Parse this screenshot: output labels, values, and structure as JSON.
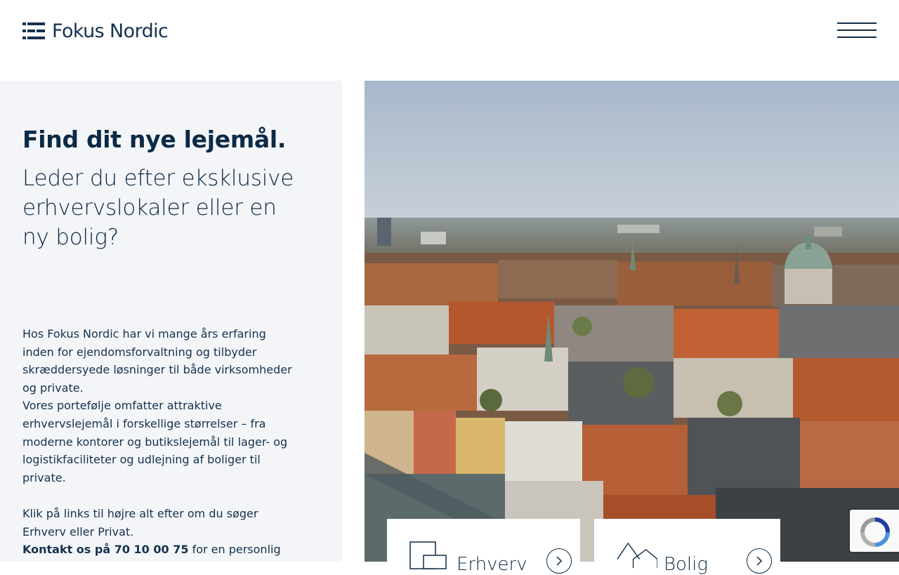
{
  "header": {
    "logo_text": "Fokus Nordic",
    "logo_icon": "fokus-nordic-mark",
    "menu_icon": "hamburger-menu-icon"
  },
  "intro": {
    "headline": "Find dit nye lejemål.",
    "subheadline": "Leder du efter eksklusive erhvervslokaler eller en ny bolig?",
    "paragraph_1": "Hos Fokus Nordic har vi mange års erfaring inden for ejendomsforvaltning og tilbyder skræddersyede løsninger til både virksomheder og private.",
    "paragraph_2": "Vores portefølje omfatter attraktive erhvervslejemål i forskellige størrelser – fra moderne kontorer og butikslejemål til lager- og logistikfaciliteter og udlejning af boliger til private.",
    "paragraph_3": "Klik på links til højre alt efter om du søger Erhverv eller Privat.",
    "contact_bold": "Kontakt os på 70 10 00 75",
    "contact_rest": " for en personlig"
  },
  "hero": {
    "image_subject": "aerial-city-skyline-copenhagen"
  },
  "cards": {
    "erhverv": {
      "label": "Erhverv",
      "icon": "office-building-icon",
      "arrow_icon": "chevron-right-circle-icon"
    },
    "bolig": {
      "label": "Bolig",
      "icon": "houses-icon",
      "arrow_icon": "chevron-right-circle-icon"
    }
  },
  "recaptcha": {
    "icon": "recaptcha-icon"
  },
  "colors": {
    "brand_navy": "#0b2a46",
    "panel_bg": "#f4f5f8",
    "white": "#ffffff"
  }
}
